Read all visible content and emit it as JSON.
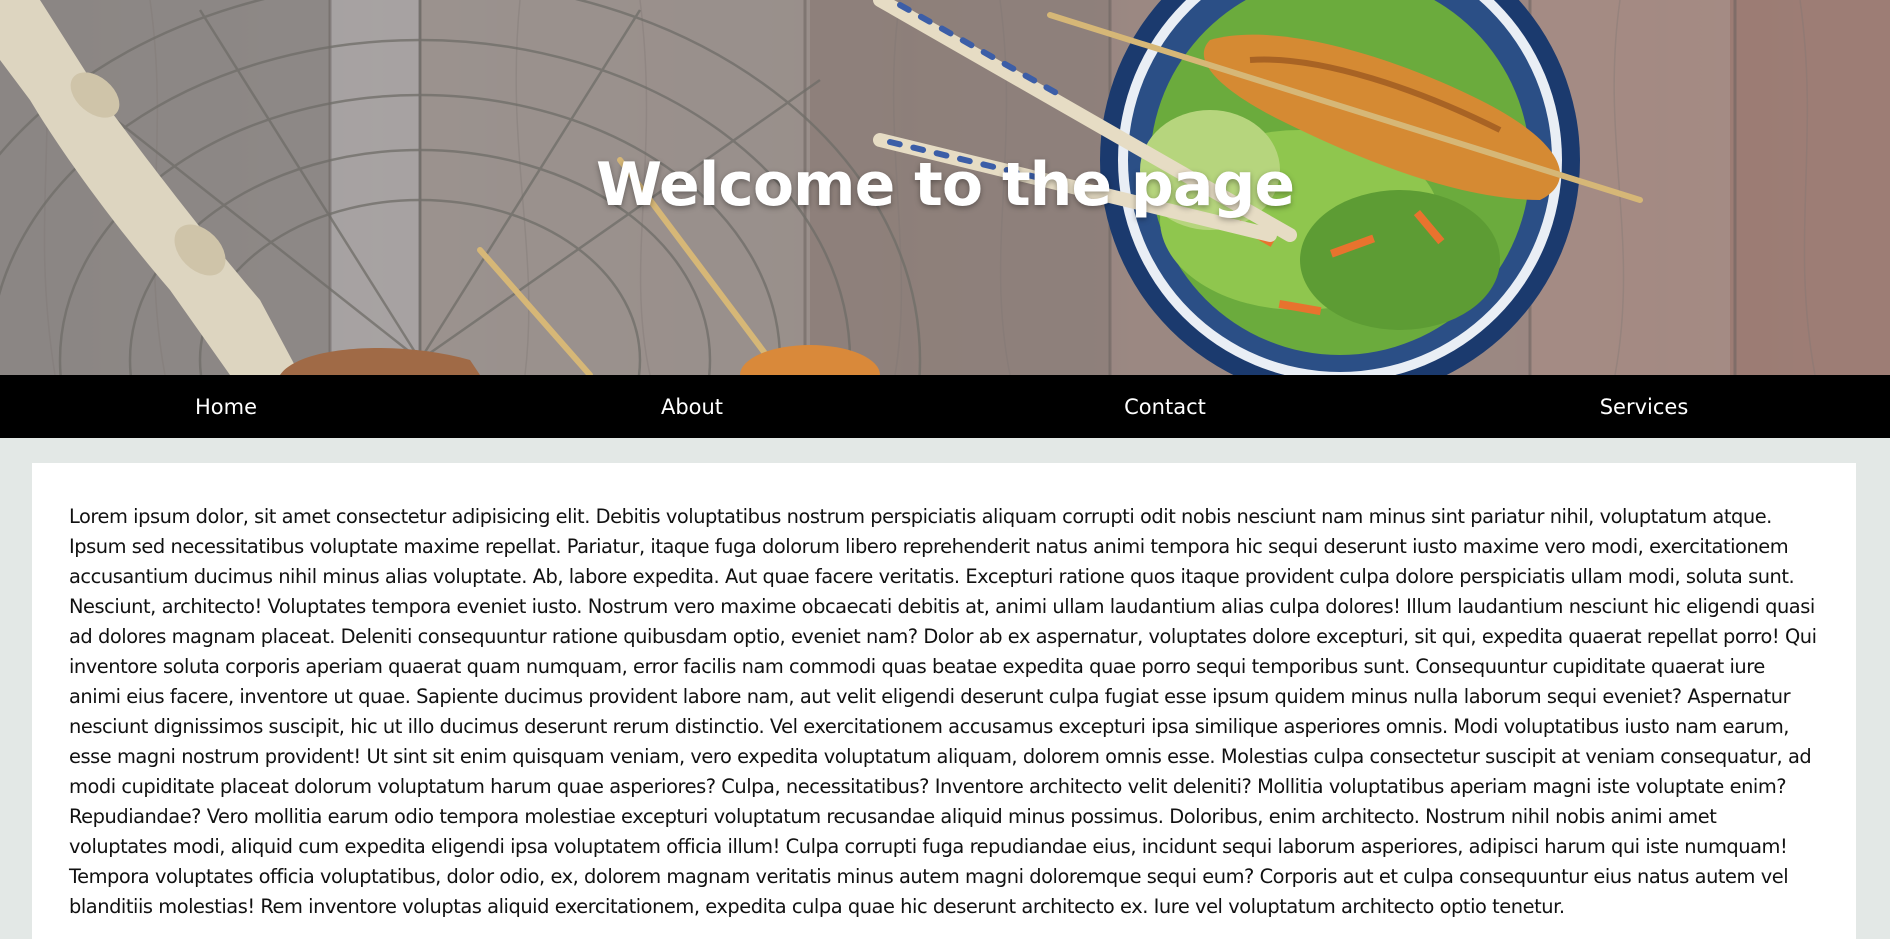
{
  "hero": {
    "title": "Welcome to the page"
  },
  "nav": {
    "items": [
      {
        "label": "Home"
      },
      {
        "label": "About"
      },
      {
        "label": "Contact"
      },
      {
        "label": "Services"
      }
    ]
  },
  "content": {
    "paragraph": "Lorem ipsum dolor, sit amet consectetur adipisicing elit. Debitis voluptatibus nostrum perspiciatis aliquam corrupti odit nobis nesciunt nam minus sint pariatur nihil, voluptatum atque. Ipsum sed necessitatibus voluptate maxime repellat. Pariatur, itaque fuga dolorum libero reprehenderit natus animi tempora hic sequi deserunt iusto maxime vero modi, exercitationem accusantium ducimus nihil minus alias voluptate. Ab, labore expedita. Aut quae facere veritatis. Excepturi ratione quos itaque provident culpa dolore perspiciatis ullam modi, soluta sunt. Nesciunt, architecto! Voluptates tempora eveniet iusto. Nostrum vero maxime obcaecati debitis at, animi ullam laudantium alias culpa dolores! Illum laudantium nesciunt hic eligendi quasi ad dolores magnam placeat. Deleniti consequuntur ratione quibusdam optio, eveniet nam? Dolor ab ex aspernatur, voluptates dolore excepturi, sit qui, expedita quaerat repellat porro! Qui inventore soluta corporis aperiam quaerat quam numquam, error facilis nam commodi quas beatae expedita quae porro sequi temporibus sunt. Consequuntur cupiditate quaerat iure animi eius facere, inventore ut quae. Sapiente ducimus provident labore nam, aut velit eligendi deserunt culpa fugiat esse ipsum quidem minus nulla laborum sequi eveniet? Aspernatur nesciunt dignissimos suscipit, hic ut illo ducimus deserunt rerum distinctio. Vel exercitationem accusamus excepturi ipsa similique asperiores omnis. Modi voluptatibus iusto nam earum, esse magni nostrum provident! Ut sint sit enim quisquam veniam, vero expedita voluptatum aliquam, dolorem omnis esse. Molestias culpa consectetur suscipit at veniam consequatur, ad modi cupiditate placeat dolorum voluptatum harum quae asperiores? Culpa, necessitatibus? Inventore architecto velit deleniti? Mollitia voluptatibus aperiam magni iste voluptate enim? Repudiandae? Vero mollitia earum odio tempora molestiae excepturi voluptatum recusandae aliquid minus possimus. Doloribus, enim architecto. Nostrum nihil nobis animi amet voluptates modi, aliquid cum expedita eligendi ipsa voluptatem officia illum! Culpa corrupti fuga repudiandae eius, incidunt sequi laborum asperiores, adipisci harum qui iste numquam! Tempora voluptates officia voluptatibus, dolor odio, ex, dolorem magnam veritatis minus autem magni doloremque sequi eum? Corporis aut et culpa consequuntur eius natus autem vel blanditiis molestias! Rem inventore voluptas aliquid exercitationem, expedita culpa quae hic deserunt architecto ex. Iure vel voluptatum architecto optio tenetur."
  }
}
